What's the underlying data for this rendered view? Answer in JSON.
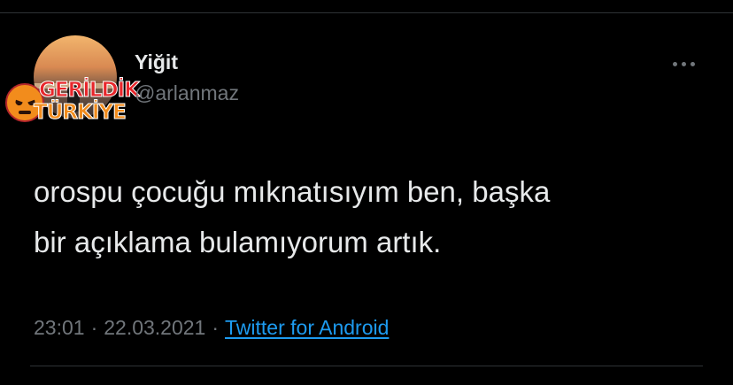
{
  "author": {
    "display_name": "Yiğit",
    "handle": "@arlanmaz"
  },
  "watermark": {
    "line1": "GERİLDİK",
    "line2": "TÜRKİYE"
  },
  "tweet": {
    "lines": [
      "orospu çocuğu mıknatısıyım ben, başka",
      "bir açıklama bulamıyorum artık."
    ]
  },
  "meta": {
    "time": "23:01",
    "separator": "·",
    "date": "22.03.2021",
    "source": "Twitter for Android"
  },
  "icons": {
    "more": "more-horizontal-icon"
  },
  "colors": {
    "background": "#000000",
    "primary_text": "#e7e9ea",
    "secondary_text": "#71767b",
    "link": "#1d9bf0",
    "divider": "#2f3336"
  }
}
